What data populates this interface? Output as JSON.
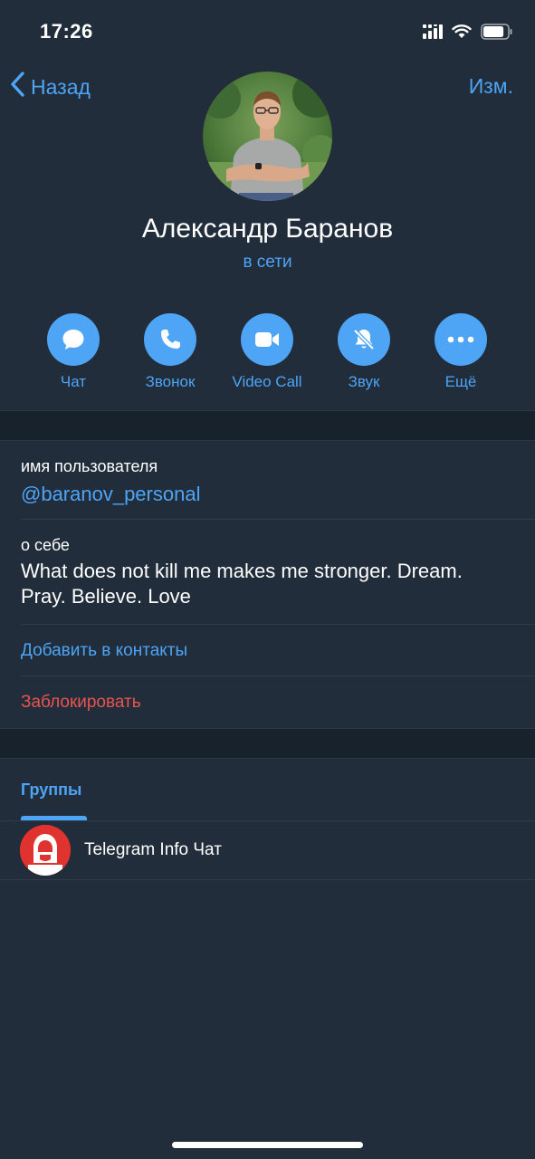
{
  "status_bar": {
    "time": "17:26",
    "battery_level": 0.85
  },
  "nav": {
    "back_label": "Назад",
    "edit_label": "Изм."
  },
  "profile": {
    "name": "Александр Баранов",
    "status": "в сети"
  },
  "actions": [
    {
      "label": "Чат",
      "icon": "chat-bubble-icon"
    },
    {
      "label": "Звонок",
      "icon": "phone-icon"
    },
    {
      "label": "Video Call",
      "icon": "video-camera-icon"
    },
    {
      "label": "Звук",
      "icon": "bell-muted-icon"
    },
    {
      "label": "Ещё",
      "icon": "more-dots-icon"
    }
  ],
  "info": {
    "username_label": "имя пользователя",
    "username_value": "@baranov_personal",
    "bio_label": "о себе",
    "bio_line1": "What does not kill me makes me stronger. Dream.",
    "bio_line2": "Pray. Believe. Love",
    "add_contact": "Добавить в контакты",
    "block": "Заблокировать"
  },
  "tabs": {
    "groups": "Группы"
  },
  "groups": [
    {
      "name": "Telegram Info Чат"
    }
  ],
  "colors": {
    "accent": "#4ea4f5",
    "danger": "#e8544f",
    "background": "#212d3b",
    "band": "#18222d"
  }
}
